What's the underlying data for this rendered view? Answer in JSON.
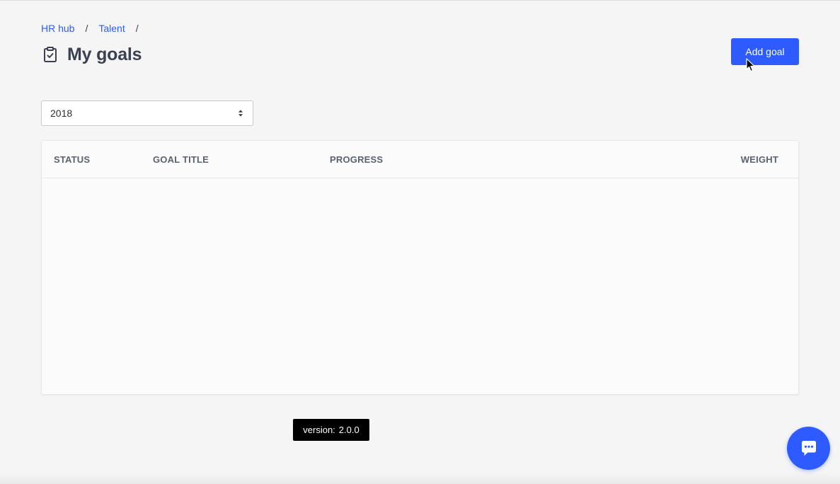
{
  "breadcrumb": {
    "items": [
      {
        "label": "HR hub"
      },
      {
        "label": "Talent"
      }
    ],
    "separator": "/"
  },
  "page": {
    "title": "My goals",
    "title_icon": "clipboard-check-icon"
  },
  "actions": {
    "add_goal_label": "Add goal"
  },
  "filters": {
    "year": {
      "selected": "2018"
    }
  },
  "table": {
    "columns": [
      "STATUS",
      "GOAL TITLE",
      "PROGRESS",
      "WEIGHT"
    ],
    "rows": []
  },
  "footer": {
    "version_label": "version:",
    "version_value": "2.0.0"
  },
  "chat": {
    "icon": "chat-bubble-icon"
  },
  "colors": {
    "accent": "#2e5bff",
    "text": "#3b4151",
    "background": "#f5f5f6"
  }
}
